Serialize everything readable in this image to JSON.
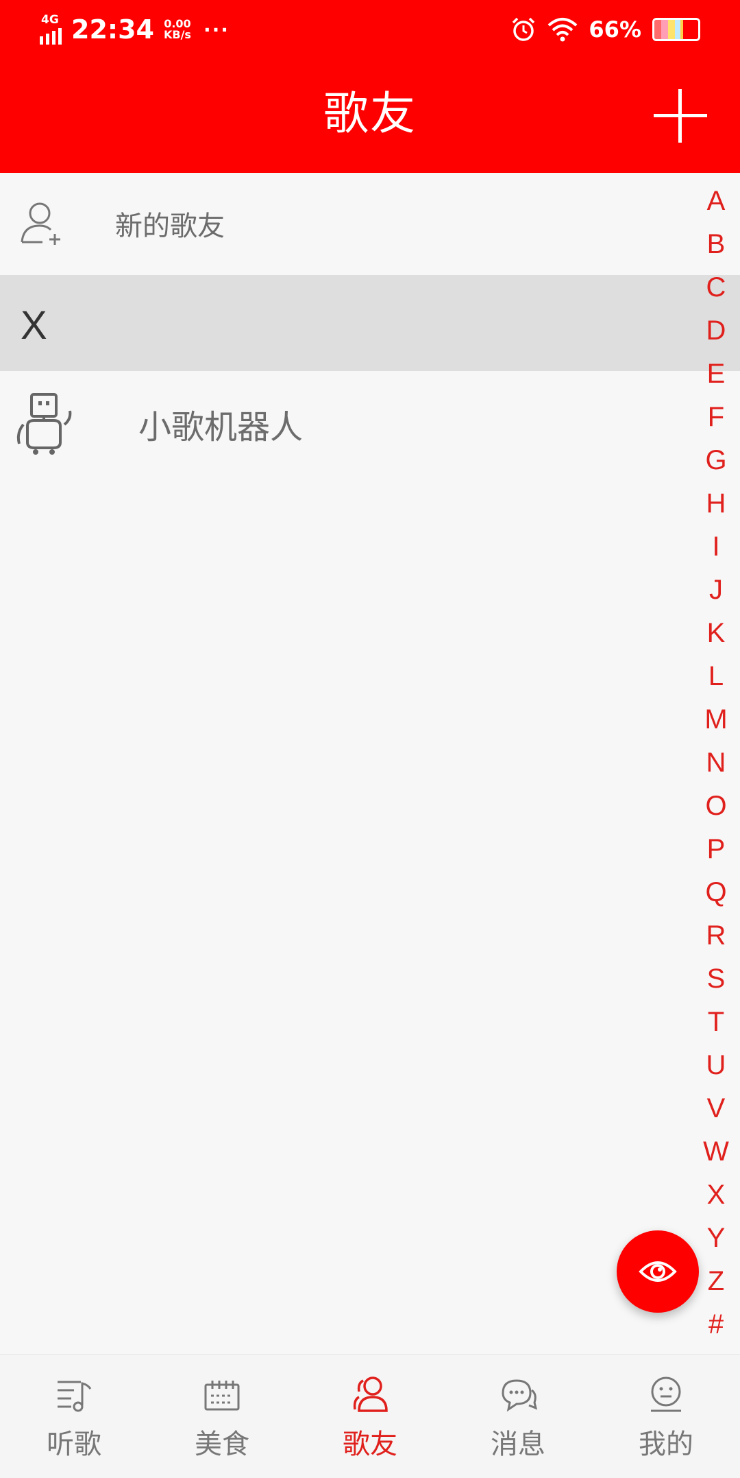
{
  "status_bar": {
    "network": "4G",
    "time": "22:34",
    "speed_value": "0.00",
    "speed_unit": "KB/s",
    "more": "···",
    "battery_percent": "66%",
    "icons": [
      "alarm-icon",
      "wifi-icon",
      "battery-icon"
    ]
  },
  "header": {
    "title": "歌友",
    "add_icon": "plus-icon"
  },
  "list": {
    "new_friends_label": "新的歌友",
    "sections": [
      {
        "letter": "X",
        "items": [
          {
            "name": "小歌机器人",
            "icon": "robot-avatar-icon"
          }
        ]
      }
    ]
  },
  "index_letters": [
    "A",
    "B",
    "C",
    "D",
    "E",
    "F",
    "G",
    "H",
    "I",
    "J",
    "K",
    "L",
    "M",
    "N",
    "O",
    "P",
    "Q",
    "R",
    "S",
    "T",
    "U",
    "V",
    "W",
    "X",
    "Y",
    "Z",
    "#"
  ],
  "fab": {
    "icon": "eye-icon"
  },
  "tabs": [
    {
      "label": "听歌",
      "icon": "music-list-icon",
      "active": false
    },
    {
      "label": "美食",
      "icon": "food-icon",
      "active": false
    },
    {
      "label": "歌友",
      "icon": "friends-icon",
      "active": true
    },
    {
      "label": "消息",
      "icon": "chat-icon",
      "active": false
    },
    {
      "label": "我的",
      "icon": "profile-icon",
      "active": false
    }
  ],
  "colors": {
    "accent": "#ff0000",
    "index_text": "#e0201c",
    "section_bg": "#dedede",
    "page_bg": "#f7f7f7"
  }
}
